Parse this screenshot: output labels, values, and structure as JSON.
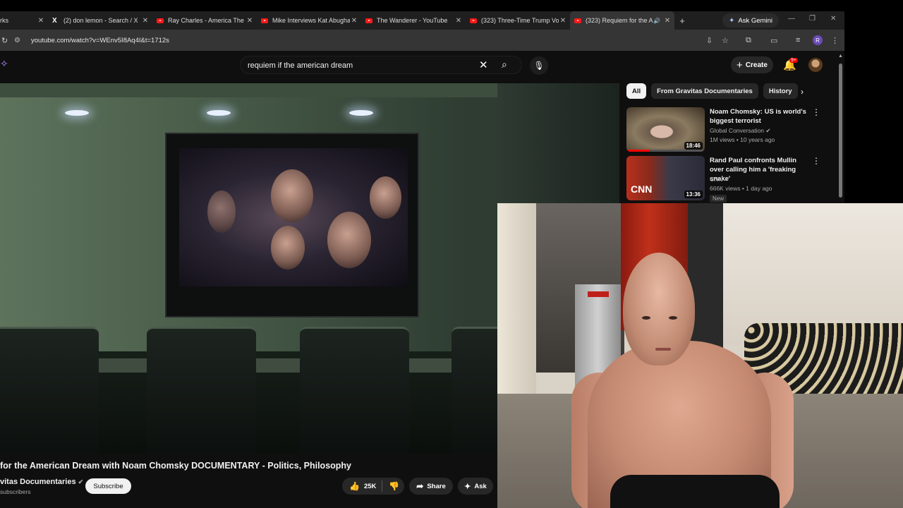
{
  "browser": {
    "tabs": [
      {
        "label": "rks",
        "icon": "bookmark-icon",
        "active": false
      },
      {
        "label": "(2) don lemon - Search / X",
        "icon": "x-logo-icon",
        "active": false
      },
      {
        "label": "Ray Charles - America The B",
        "icon": "youtube-icon",
        "active": false
      },
      {
        "label": "Mike Interviews Kat Abugha",
        "icon": "youtube-icon",
        "active": false
      },
      {
        "label": "The Wanderer - YouTube",
        "icon": "youtube-icon",
        "active": false
      },
      {
        "label": "(323) Three-Time Trump Vot",
        "icon": "youtube-icon",
        "active": false
      },
      {
        "label": "(323) Requiem for the A",
        "icon": "youtube-icon",
        "active": true
      }
    ],
    "ask_gemini": "Ask Gemini",
    "url": "youtube.com/watch?v=WEnv5I8Aq4I&t=1712s",
    "profile_initial": "R"
  },
  "youtube": {
    "search": {
      "value": "requiem if the american dream",
      "placeholder": "Search"
    },
    "create_label": "Create",
    "notification_count": "9+"
  },
  "video": {
    "title": "for the American Dream with Noam Chomsky DOCUMENTARY - Politics, Philosophy",
    "channel": "vitas Documentaries",
    "subscribers": "subscribers",
    "subscribe_label": "Subscribe",
    "likes": "25K",
    "share_label": "Share",
    "ask_label": "Ask"
  },
  "sidebar": {
    "chips": [
      "All",
      "From Gravitas Documentaries",
      "History"
    ],
    "recommendations": [
      {
        "title": "Noam Chomsky: US is world's biggest terrorist",
        "channel": "Global Conversation",
        "meta": "1M views • 10 years ago",
        "duration": "18:46",
        "watched_fraction": 0.3,
        "badge": ""
      },
      {
        "title": "Rand Paul confronts Mullin over calling him a 'freaking snake'",
        "channel": "CNN",
        "meta": "666K views • 1 day ago",
        "duration": "13:36",
        "watched_fraction": 0,
        "badge": "New"
      }
    ]
  },
  "colors": {
    "youtube_red": "#ff0000",
    "background": "#0f0f0f",
    "chip_bg": "#272727"
  }
}
